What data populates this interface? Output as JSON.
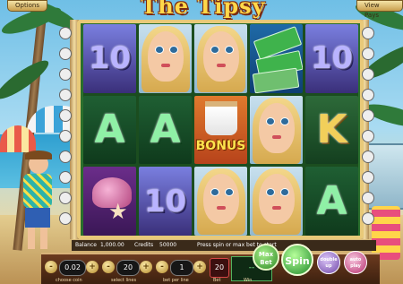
{
  "game": {
    "title": "The Tipsy Tourist",
    "options_label": "Options",
    "view_pays_label": "View Pays"
  },
  "reels": [
    [
      "10",
      "A",
      "shell-starfish"
    ],
    [
      "blonde",
      "A",
      "10"
    ],
    [
      "blonde",
      "BONUS",
      "blonde"
    ],
    [
      "tickets",
      "blonde",
      "blonde"
    ],
    [
      "10",
      "K",
      "A"
    ]
  ],
  "bonus_label": "BONUS",
  "status": {
    "balance_label": "Balance",
    "balance_value": "1,000.00",
    "credits_label": "Credits",
    "credits_value": "50000",
    "message": "Press spin or max bet to start"
  },
  "controls": {
    "coin_value": "0.02",
    "coin_label": "choose coin",
    "lines_value": "20",
    "lines_label": "select lines",
    "bet_per_line_value": "1",
    "bet_per_line_label": "bet per line",
    "bet_value": "20",
    "bet_label": "Bet",
    "win_value": "--",
    "win_label": "Win",
    "max_bet_label": "Max Bet",
    "spin_label": "Spin",
    "double_up_label": "double up",
    "auto_play_label": "auto play",
    "minus": "-",
    "plus": "+"
  },
  "colors": {
    "frame": "#e8c979",
    "spin": "#3bb54a",
    "max_bet": "#4fae3f",
    "double_up": "#9b6fc7",
    "auto_play": "#d94c8f"
  }
}
